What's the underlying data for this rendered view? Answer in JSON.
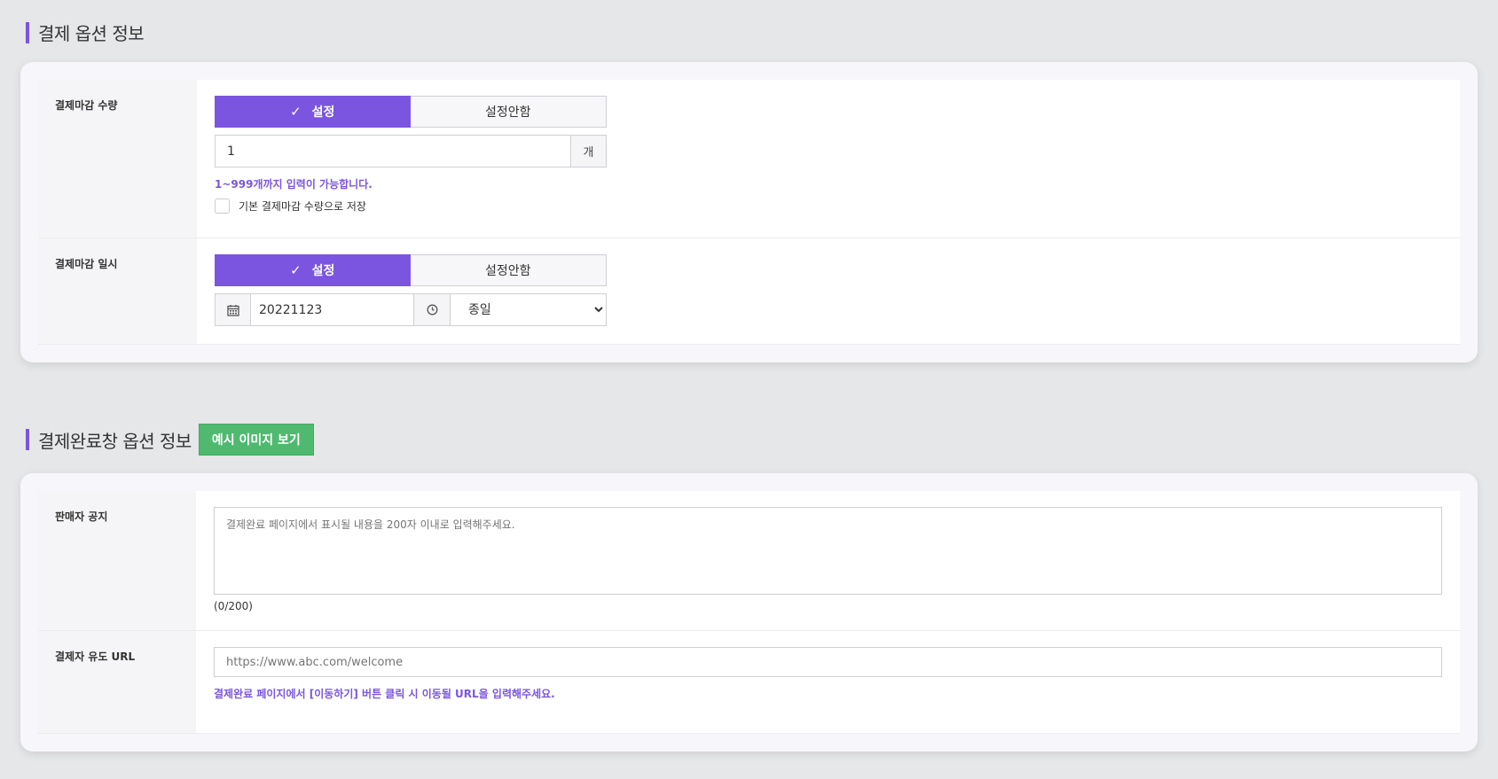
{
  "section1": {
    "title": "결제 옵션 정보",
    "rows": {
      "quantity": {
        "label": "결제마감 수량",
        "toggle_on": "설정",
        "toggle_off": "설정안함",
        "value": "1",
        "unit": "개",
        "help": "1~999개까지 입력이 가능합니다.",
        "checkbox_label": "기본 결제마감 수량으로 저장"
      },
      "datetime": {
        "label": "결제마감 일시",
        "toggle_on": "설정",
        "toggle_off": "설정안함",
        "date_value": "20221123",
        "time_selected": "종일"
      }
    }
  },
  "section2": {
    "title": "결제완료창 옵션 정보",
    "example_button": "예시 이미지 보기",
    "rows": {
      "notice": {
        "label": "판매자 공지",
        "placeholder": "결제완료 페이지에서 표시될 내용을 200자 이내로 입력해주세요.",
        "counter": "(0/200)"
      },
      "url": {
        "label": "결제자 유도 URL",
        "placeholder": "https://www.abc.com/welcome",
        "help": "결제완료 페이지에서 [이동하기] 버튼 클릭 시 이동될 URL을 입력해주세요."
      }
    }
  },
  "icons": {
    "check": "check-icon",
    "calendar": "calendar-icon",
    "clock": "clock-icon"
  },
  "colors": {
    "accent": "#7b55e0",
    "green": "#4fba6f",
    "background": "#e6e7e9"
  }
}
